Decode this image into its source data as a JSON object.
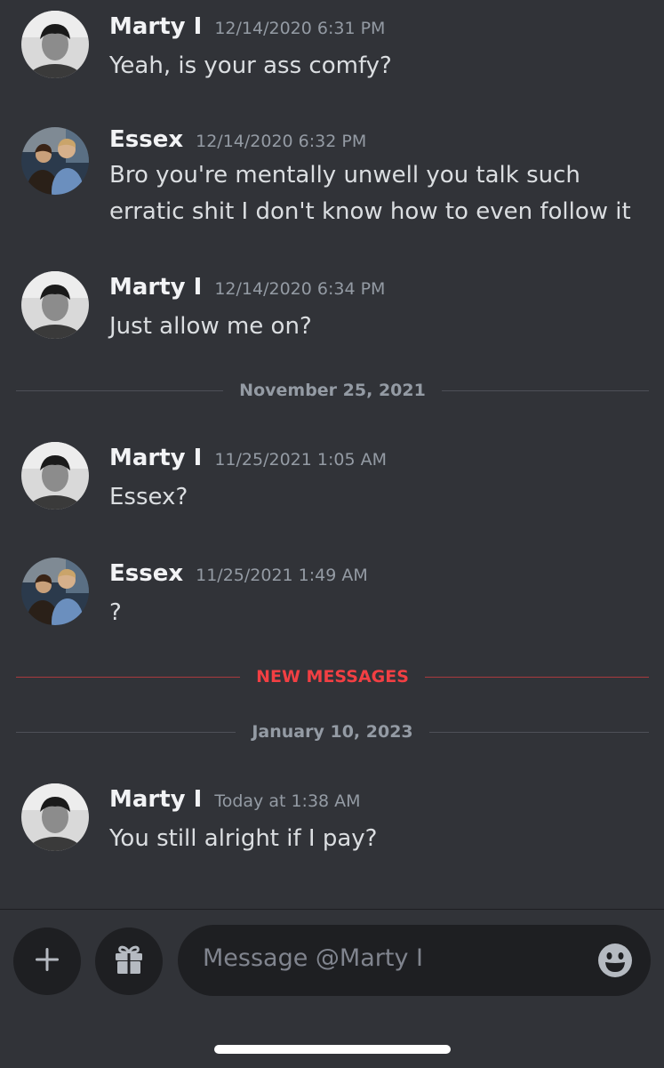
{
  "messages": [
    {
      "author": "Marty I",
      "timestamp": "12/14/2020 6:31 PM",
      "lines": [
        "Yeah, is your ass comfy?"
      ]
    },
    {
      "author": "Essex",
      "timestamp": "12/14/2020 6:32 PM",
      "lines": [
        "Bro you're mentally unwell you talk such",
        "erratic shit I don't know how to even follow it"
      ]
    },
    {
      "author": "Marty I",
      "timestamp": "12/14/2020 6:34 PM",
      "lines": [
        "Just allow me on?"
      ]
    },
    {
      "author": "Marty I",
      "timestamp": "11/25/2021 1:05 AM",
      "lines": [
        "Essex?"
      ]
    },
    {
      "author": "Essex",
      "timestamp": "11/25/2021 1:49 AM",
      "lines": [
        "?"
      ]
    },
    {
      "author": "Marty I",
      "timestamp": "Today at 1:38 AM",
      "lines": [
        "You still alright if I pay?"
      ]
    }
  ],
  "dividers": {
    "date_1": "November 25, 2021",
    "new_messages": "NEW MESSAGES",
    "date_2": "January 10, 2023"
  },
  "composer": {
    "placeholder": "Message @Marty I",
    "add_icon": "plus-icon",
    "gift_icon": "gift-icon",
    "emoji_icon": "emoji-icon"
  },
  "colors": {
    "background": "#313338",
    "input": "#1e1f22",
    "new_messages": "#f23f43"
  }
}
